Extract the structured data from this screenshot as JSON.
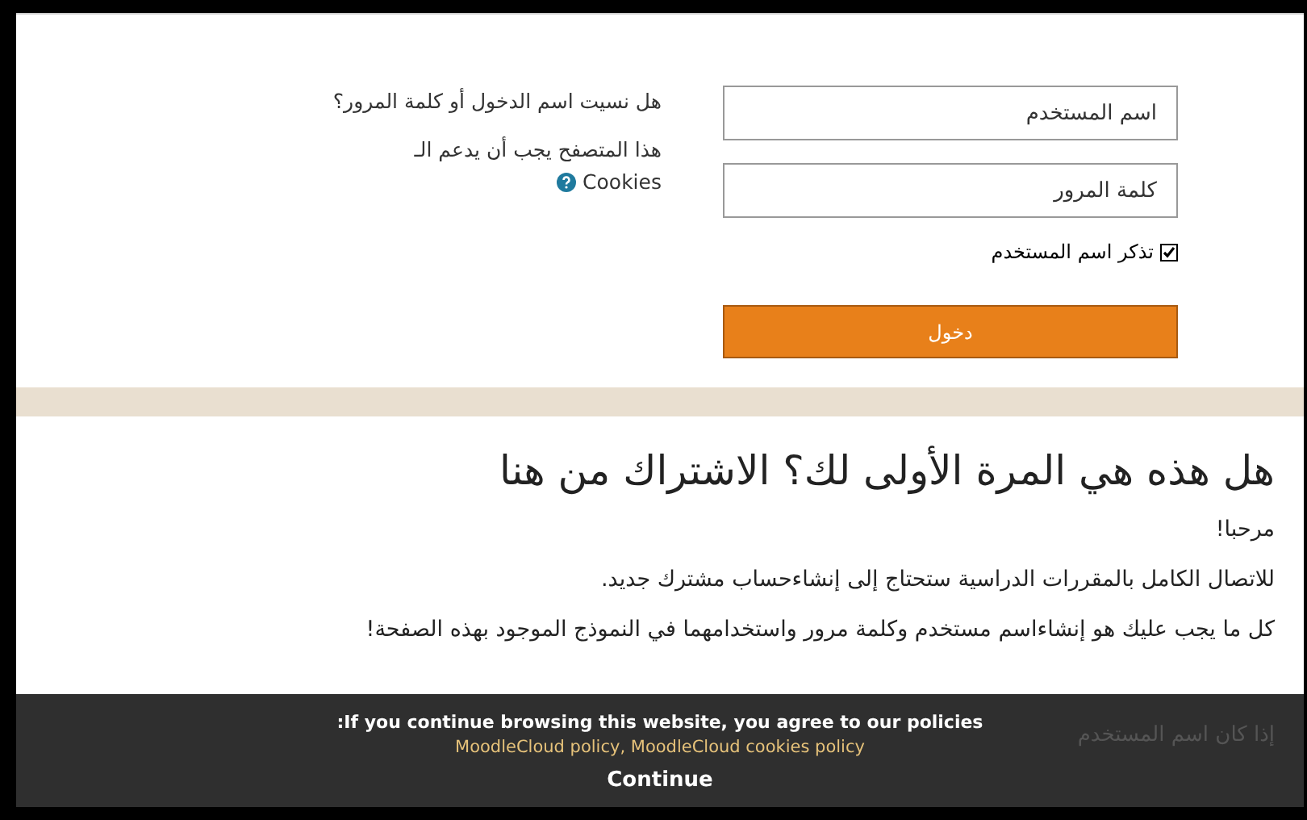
{
  "login": {
    "username": {
      "placeholder": "اسم المستخدم"
    },
    "password": {
      "placeholder": "كلمة المرور"
    },
    "remember": {
      "label": "تذكر اسم المستخدم",
      "checked": true
    },
    "submit": "دخول",
    "forgot_link": "هل نسيت اسم الدخول أو كلمة المرور؟",
    "cookies_note": "هذا المتصفح يجب أن يدعم الـ",
    "cookies_word": "Cookies"
  },
  "signup": {
    "heading": "هل هذه هي المرة الأولى لك؟ الاشتراك من هنا",
    "paragraphs": [
      "مرحبا!",
      "للاتصال الكامل بالمقررات الدراسية ستحتاج إلى إنشاءحساب مشترك جديد.",
      "كل ما يجب عليك هو إنشاءاسم مستخدم وكلمة مرور واستخدامهما في النموذج الموجود بهذه الصفحة!"
    ],
    "covered_text": "إذا كان اسم المستخدم"
  },
  "cookie_bar": {
    "message": ":If you continue browsing this website, you agree to our policies",
    "links_text": "MoodleCloud policy, MoodleCloud cookies policy",
    "button": "Continue"
  }
}
